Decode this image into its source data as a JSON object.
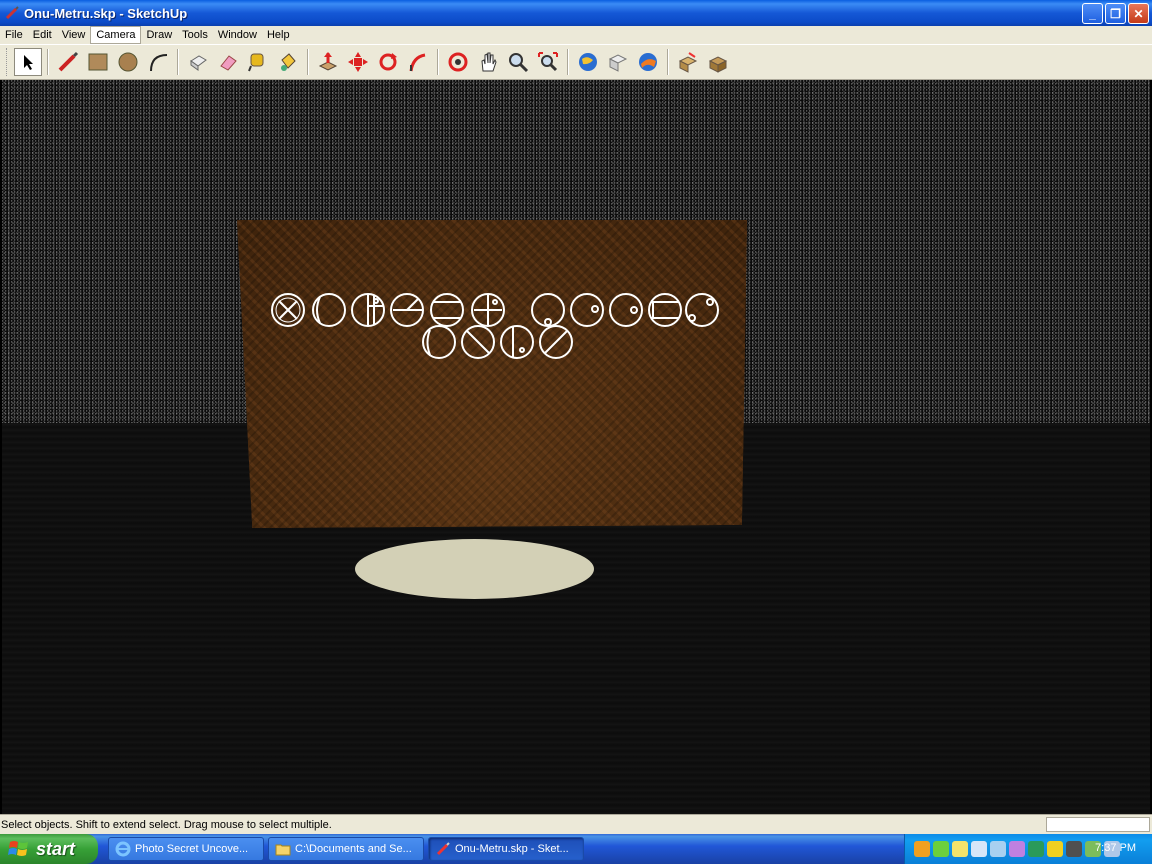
{
  "window": {
    "title": "Onu-Metru.skp - SketchUp",
    "minimize_label": "_",
    "restore_label": "❐",
    "close_label": "✕"
  },
  "menu": [
    "File",
    "Edit",
    "View",
    "Camera",
    "Draw",
    "Tools",
    "Window",
    "Help"
  ],
  "toolbar": {
    "tools": [
      "select-tool-icon",
      "pencil-line-icon",
      "rectangle-icon",
      "circle-icon",
      "arc-icon",
      "make-component-icon",
      "eraser-icon",
      "tape-measure-icon",
      "paint-bucket-icon",
      "push-pull-icon",
      "move-icon",
      "rotate-icon",
      "follow-me-icon",
      "orbit-icon",
      "pan-icon",
      "zoom-icon",
      "zoom-extents-icon",
      "previous-view-icon",
      "next-view-icon",
      "google-earth-icon",
      "get-models-icon",
      "share-model-icon"
    ]
  },
  "status": {
    "message": "Select objects. Shift to extend select. Drag mouse to select multiple."
  },
  "taskbar": {
    "start_label": "start",
    "tasks": [
      {
        "label": "Photo Secret Uncove...",
        "icon": "internet-explorer-icon",
        "active": false
      },
      {
        "label": "C:\\Documents and Se...",
        "icon": "folder-icon",
        "active": false
      },
      {
        "label": "Onu-Metru.skp - Sket...",
        "icon": "sketchup-icon",
        "active": true
      }
    ],
    "clock": "7:37 PM"
  },
  "colors": {
    "titlebar": "#1558d6",
    "chrome": "#ece9d8",
    "board": "#4a2c12",
    "pad": "#d3d0b6",
    "taskbar": "#2157d7",
    "start": "#37a137"
  }
}
